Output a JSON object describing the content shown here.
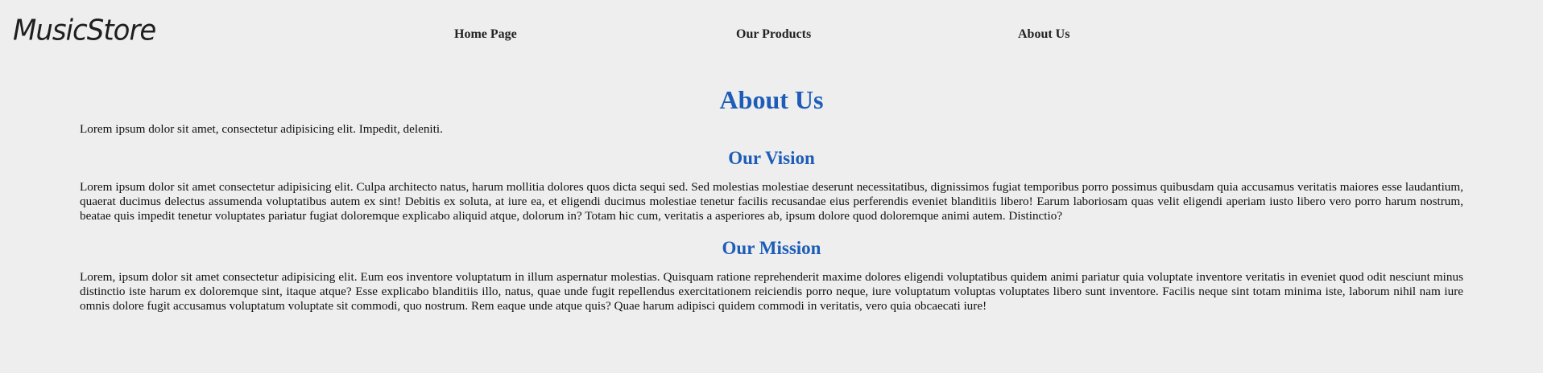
{
  "header": {
    "logo": "MusicStore",
    "nav": [
      {
        "label": "Home Page"
      },
      {
        "label": "Our Products"
      },
      {
        "label": "About Us"
      }
    ]
  },
  "about": {
    "title": "About Us",
    "intro": "Lorem ipsum dolor sit amet, consectetur adipisicing elit. Impedit, deleniti.",
    "vision": {
      "title": "Our Vision",
      "text": "Lorem ipsum dolor sit amet consectetur adipisicing elit. Culpa architecto natus, harum mollitia dolores quos dicta sequi sed. Sed molestias molestiae deserunt necessitatibus, dignissimos fugiat temporibus porro possimus quibusdam quia accusamus veritatis maiores esse laudantium, quaerat ducimus delectus assumenda voluptatibus autem ex sint! Debitis ex soluta, at iure ea, et eligendi ducimus molestiae tenetur facilis recusandae eius perferendis eveniet blanditiis libero! Earum laboriosam quas velit eligendi aperiam iusto libero vero porro harum nostrum, beatae quis impedit tenetur voluptates pariatur fugiat doloremque explicabo aliquid atque, dolorum in? Totam hic cum, veritatis a asperiores ab, ipsum dolore quod doloremque animi autem. Distinctio?"
    },
    "mission": {
      "title": "Our Mission",
      "text": "Lorem, ipsum dolor sit amet consectetur adipisicing elit. Eum eos inventore voluptatum in illum aspernatur molestias. Quisquam ratione reprehenderit maxime dolores eligendi voluptatibus quidem animi pariatur quia voluptate inventore veritatis in eveniet quod odit nesciunt minus distinctio iste harum ex doloremque sint, itaque atque? Esse explicabo blanditiis illo, natus, quae unde fugit repellendus exercitationem reiciendis porro neque, iure voluptatum voluptas voluptates libero sunt inventore. Facilis neque sint totam minima iste, laborum nihil nam iure omnis dolore fugit accusamus voluptatum voluptate sit commodi, quo nostrum. Rem eaque unde atque quis? Quae harum adipisci quidem commodi in veritatis, vero quia obcaecati iure!"
    }
  },
  "colors": {
    "background": "#eeeeee",
    "heading": "#1d5db8",
    "text": "#111111"
  }
}
